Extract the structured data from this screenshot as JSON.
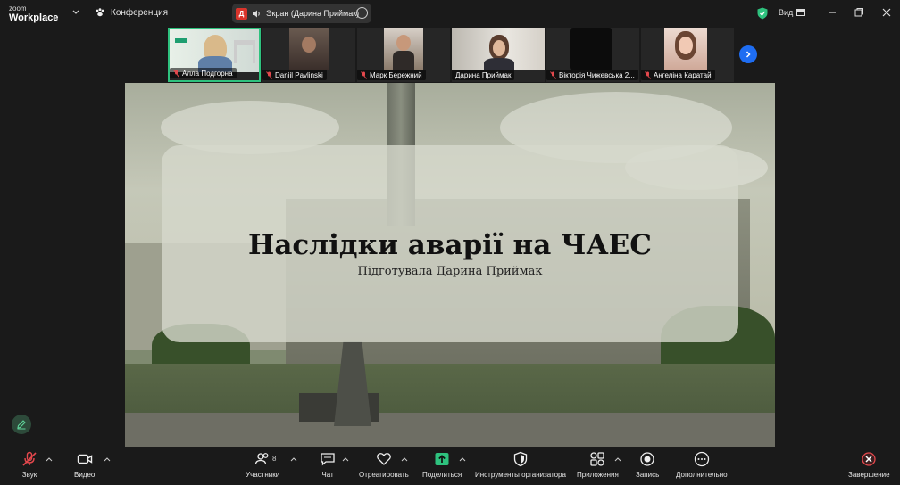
{
  "app": {
    "logo_line1": "zoom",
    "logo_line2": "Workplace",
    "conference_label": "Конференция",
    "screen_share_badge": "Д",
    "screen_share_label": "Экран (Дарина Приймак)",
    "view_label": "Вид"
  },
  "participants": [
    {
      "name": "Алла Подгорна",
      "active": true
    },
    {
      "name": "Daniil Pavlinski",
      "active": false
    },
    {
      "name": "Марк Бережний",
      "active": false
    },
    {
      "name": "Дарина Приймак",
      "active": false
    },
    {
      "name": "Вікторія Чижевська 2...",
      "active": false
    },
    {
      "name": "Ангеліна Каратай",
      "active": false
    }
  ],
  "slide": {
    "title": "Наслідки аварії на ЧАЕС",
    "subtitle": "Підготувала Дарина Приймак"
  },
  "toolbar": {
    "audio": "Звук",
    "video": "Видео",
    "participants": "Участники",
    "participants_count": "8",
    "chat": "Чат",
    "react": "Отреагировать",
    "share": "Поделиться",
    "host_tools": "Инструменты организатора",
    "apps": "Приложения",
    "record": "Запись",
    "more": "Дополнительно",
    "end": "Завершение"
  },
  "colors": {
    "accent_blue": "#1e6df2",
    "share_green": "#2ec27e",
    "end_red": "#e5484d",
    "muted_red": "#d9342b"
  }
}
